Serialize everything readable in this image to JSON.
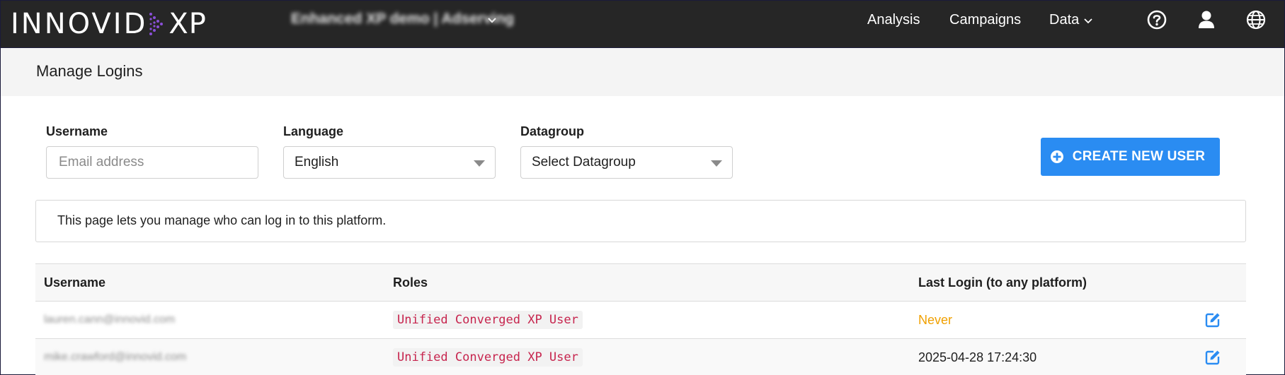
{
  "brand": {
    "logo_left": "INNOVID",
    "logo_right": "XP"
  },
  "account": {
    "name": "Enhanced XP demo | Adserving"
  },
  "nav": {
    "analysis": "Analysis",
    "campaigns": "Campaigns",
    "data": "Data"
  },
  "icons": {
    "help": "help-circle-icon",
    "user": "user-icon",
    "globe": "globe-icon",
    "edit": "edit-icon",
    "add": "plus-circle-icon"
  },
  "page": {
    "title": "Manage Logins"
  },
  "filters": {
    "username_label": "Username",
    "username_placeholder": "Email address",
    "username_value": "",
    "language_label": "Language",
    "language_value": "English",
    "datagroup_label": "Datagroup",
    "datagroup_value": "Select Datagroup"
  },
  "actions": {
    "create_user": "CREATE NEW USER"
  },
  "info": {
    "text": "This page lets you manage who can log in to this platform."
  },
  "table": {
    "headers": {
      "username": "Username",
      "roles": "Roles",
      "last_login": "Last Login (to any platform)"
    },
    "rows": [
      {
        "username": "lauren.cann@innovid.com",
        "role": "Unified Converged XP User",
        "last_login": "Never"
      },
      {
        "username": "mike.crawford@innovid.com",
        "role": "Unified Converged XP User",
        "last_login": "2025-04-28 17:24:30"
      }
    ]
  },
  "colors": {
    "topbar": "#262626",
    "accent_button": "#2a8cf2",
    "role_text": "#c7254e",
    "never_text": "#f0a000",
    "edit_icon": "#2a8cf2"
  }
}
